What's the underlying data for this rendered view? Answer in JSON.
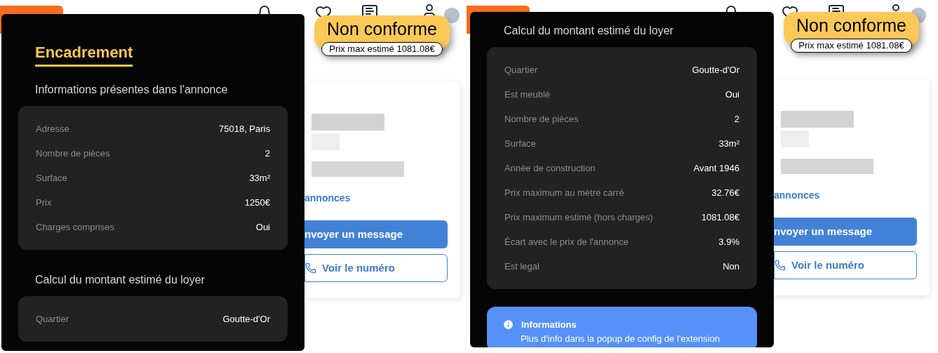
{
  "panels": [
    {
      "page": {
        "link": "annonces",
        "primary_button": "nvoyer un message",
        "secondary_button": "Voir le numéro"
      },
      "badge": {
        "status": "Non conforme",
        "detail": "Prix max estimé 1081.08€"
      },
      "popup": {
        "title": "Encadrement",
        "sections": [
          {
            "heading": "Informations présentes dans l'annonce",
            "rows": [
              {
                "label": "Adresse",
                "value": "75018, Paris"
              },
              {
                "label": "Nombre de pièces",
                "value": "2"
              },
              {
                "label": "Surface",
                "value": "33m²"
              },
              {
                "label": "Prix",
                "value": "1250€"
              },
              {
                "label": "Charges comprises",
                "value": "Oui"
              }
            ]
          },
          {
            "heading": "Calcul du montant estimé du loyer",
            "rows": [
              {
                "label": "Quartier",
                "value": "Goutte-d'Or"
              }
            ]
          }
        ]
      }
    },
    {
      "page": {
        "link": "annonces",
        "primary_button": "nvoyer un message",
        "secondary_button": "Voir le numéro"
      },
      "badge": {
        "status": "Non conforme",
        "detail": "Prix max estimé 1081.08€"
      },
      "popup": {
        "sections": [
          {
            "heading": "Calcul du montant estimé du loyer",
            "rows": [
              {
                "label": "Quartier",
                "value": "Goutte-d'Or"
              },
              {
                "label": "Est meublé",
                "value": "Oui"
              },
              {
                "label": "Nombre de pièces",
                "value": "2"
              },
              {
                "label": "Surface",
                "value": "33m²"
              },
              {
                "label": "Année de construction",
                "value": "Avant 1946"
              },
              {
                "label": "Prix maximum au mètre carré",
                "value": "32.76€"
              },
              {
                "label": "Prix maximum estimé (hors charges)",
                "value": "1081.08€"
              },
              {
                "label": "Écart avec le prix de l'annonce",
                "value": "3.9%"
              },
              {
                "label": "Est legal",
                "value": "Non"
              }
            ]
          }
        ],
        "info": {
          "title": "Informations",
          "text": "Plus d'info dans la popup de config de l'extension"
        }
      }
    }
  ]
}
